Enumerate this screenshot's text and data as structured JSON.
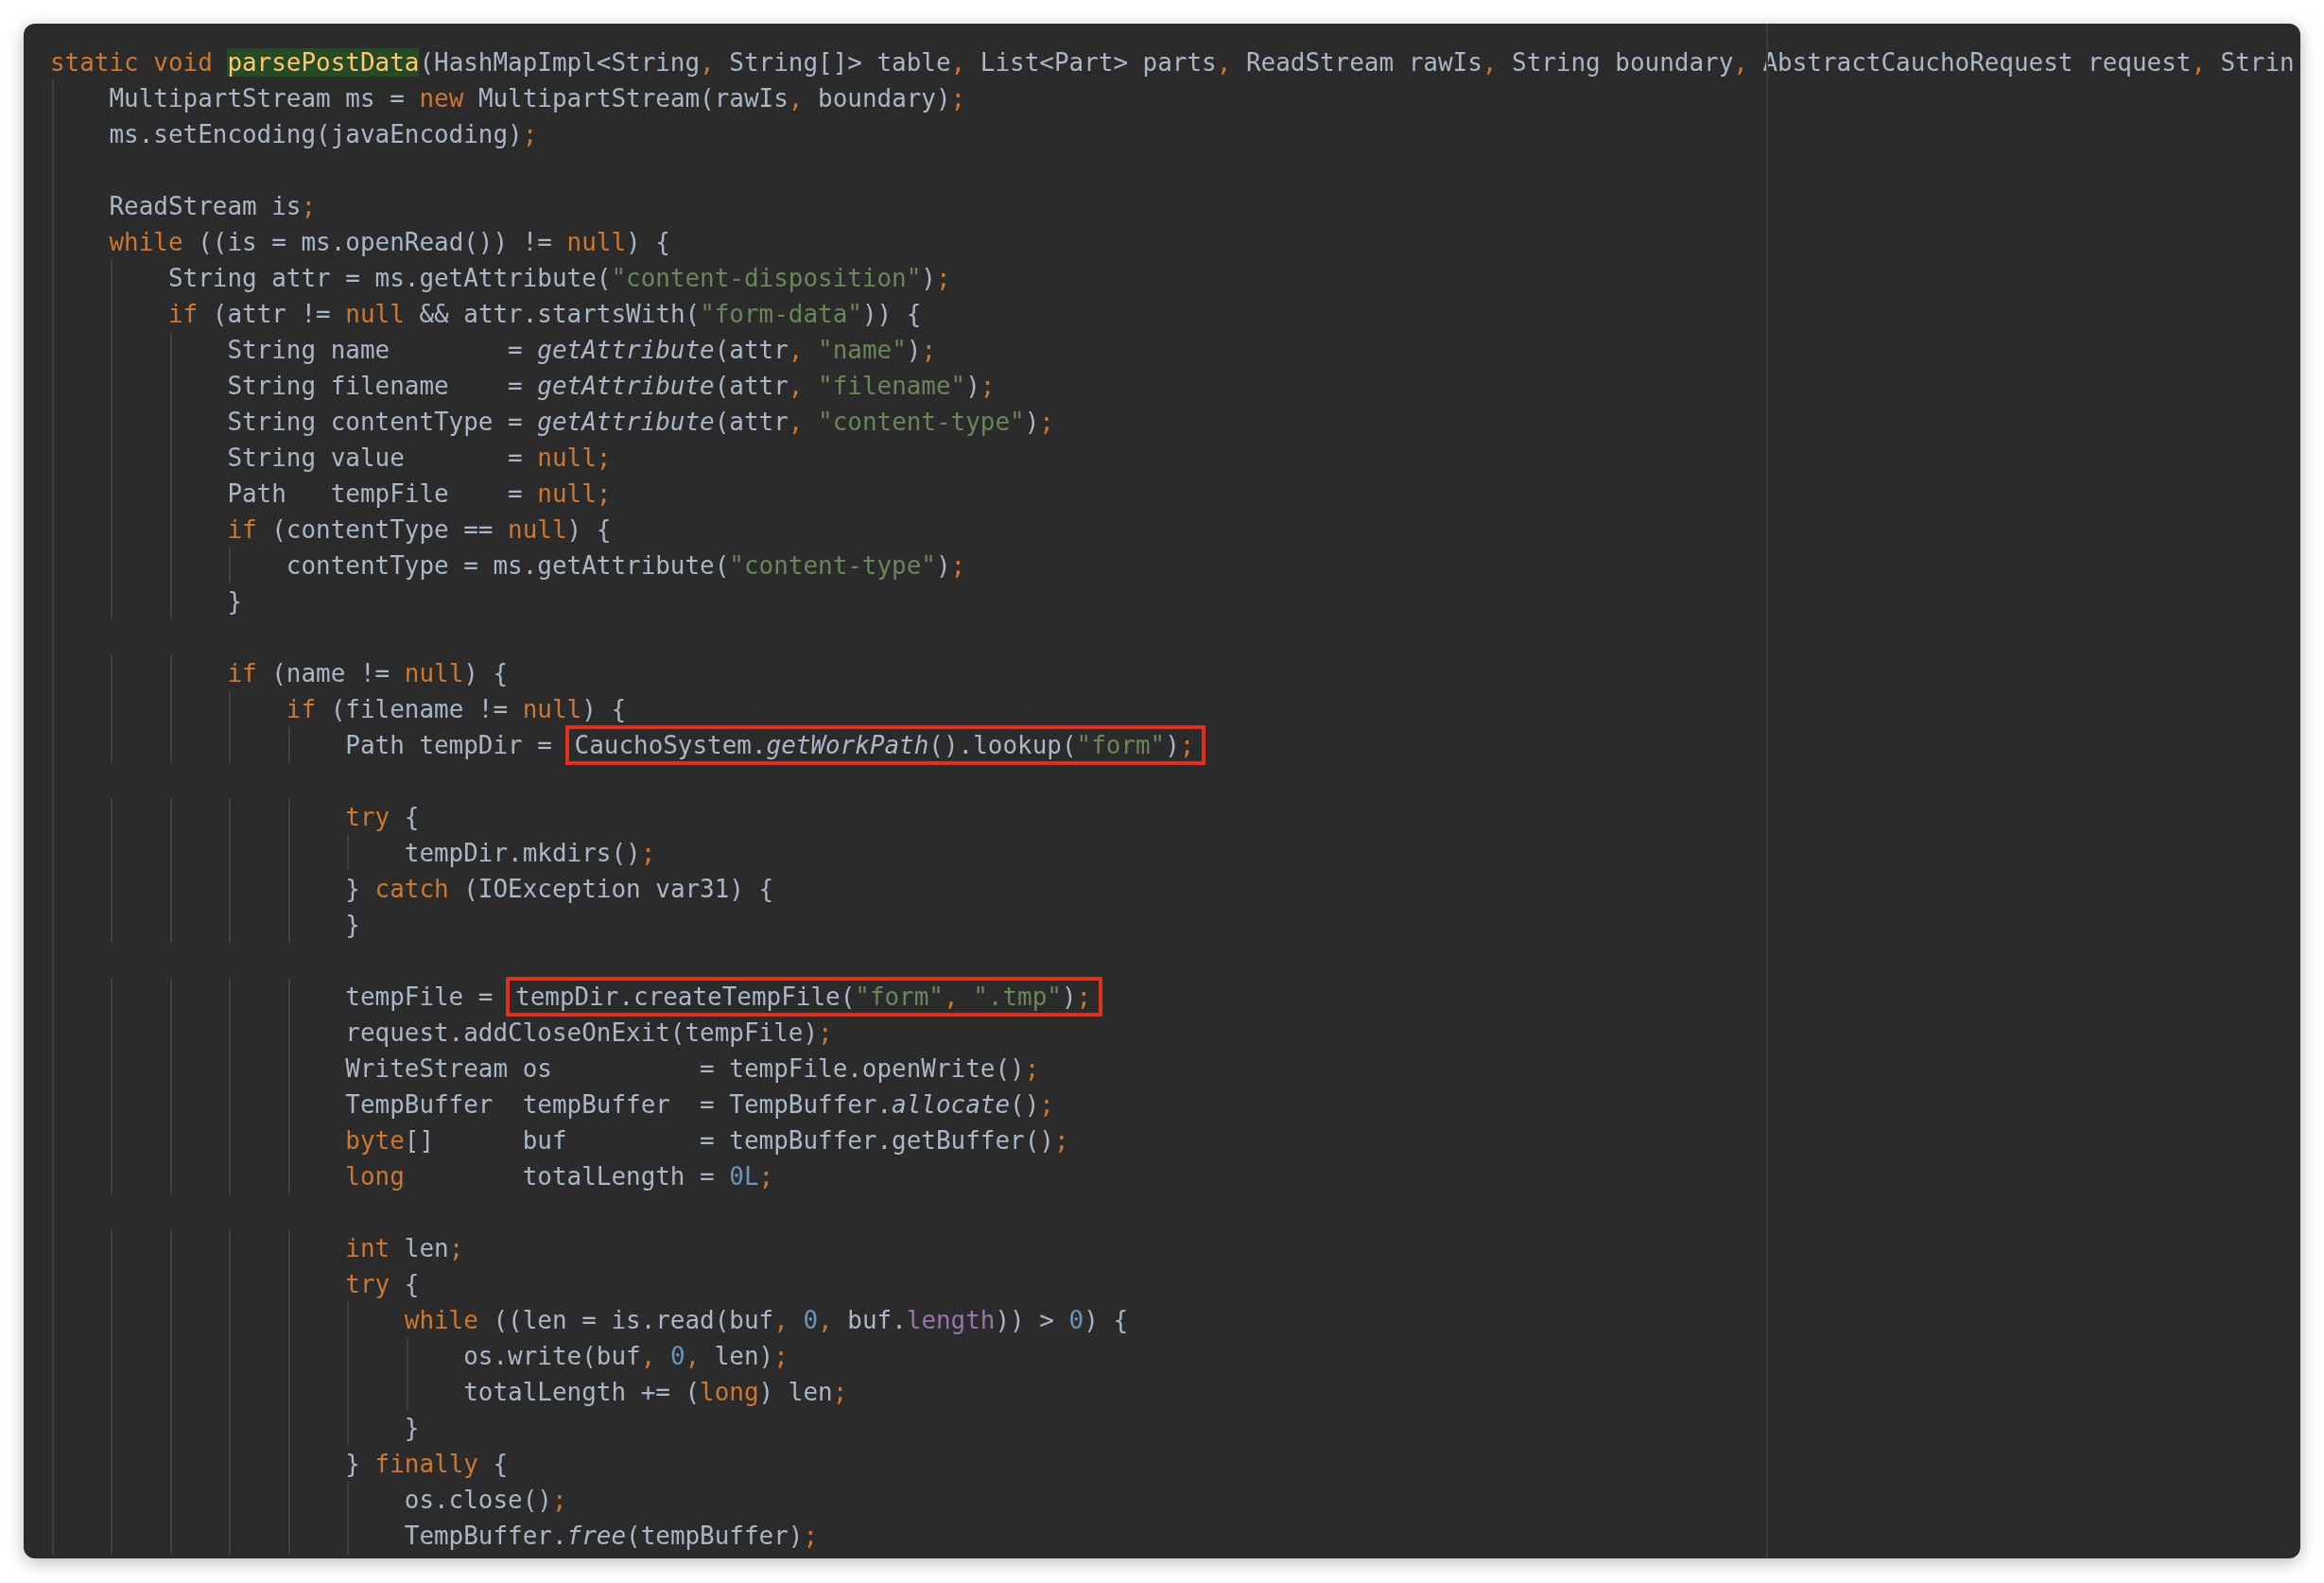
{
  "editor": {
    "lines": [
      {
        "kind": "code",
        "tokens": [
          {
            "text": "static void ",
            "kind": "keyword"
          },
          {
            "text": "parsePostData",
            "kind": "declaration"
          },
          {
            "text": "(HashMapImpl<String",
            "kind": "plain"
          },
          {
            "text": ",",
            "kind": "keyword"
          },
          {
            "text": " String[]> table",
            "kind": "plain"
          },
          {
            "text": ",",
            "kind": "keyword"
          },
          {
            "text": " List<Part> parts",
            "kind": "plain"
          },
          {
            "text": ",",
            "kind": "keyword"
          },
          {
            "text": " ReadStream rawIs",
            "kind": "plain"
          },
          {
            "text": ",",
            "kind": "keyword"
          },
          {
            "text": " String boundary",
            "kind": "plain"
          },
          {
            "text": ",",
            "kind": "keyword"
          },
          {
            "text": " AbstractCauchoRequest request",
            "kind": "plain"
          },
          {
            "text": ",",
            "kind": "keyword"
          },
          {
            "text": " Strin",
            "kind": "plain"
          }
        ]
      },
      {
        "kind": "code",
        "tokens": [
          {
            "text": "    MultipartStream ms = ",
            "kind": "plain"
          },
          {
            "text": "new",
            "kind": "keyword"
          },
          {
            "text": " MultipartStream(rawIs",
            "kind": "plain"
          },
          {
            "text": ",",
            "kind": "keyword"
          },
          {
            "text": " boundary)",
            "kind": "plain"
          },
          {
            "text": ";",
            "kind": "keyword"
          }
        ]
      },
      {
        "kind": "code",
        "tokens": [
          {
            "text": "    ms.setEncoding(javaEncoding)",
            "kind": "plain"
          },
          {
            "text": ";",
            "kind": "keyword"
          }
        ]
      },
      {
        "kind": "blank"
      },
      {
        "kind": "code",
        "tokens": [
          {
            "text": "    ReadStream is",
            "kind": "plain"
          },
          {
            "text": ";",
            "kind": "keyword"
          }
        ]
      },
      {
        "kind": "code",
        "tokens": [
          {
            "text": "    while",
            "kind": "keyword"
          },
          {
            "text": " ((is = ms.openRead()) != ",
            "kind": "plain"
          },
          {
            "text": "null",
            "kind": "keyword"
          },
          {
            "text": ") {",
            "kind": "plain"
          }
        ]
      },
      {
        "kind": "code",
        "tokens": [
          {
            "text": "        String attr = ms.getAttribute(",
            "kind": "plain"
          },
          {
            "text": "\"content-disposition\"",
            "kind": "string"
          },
          {
            "text": ")",
            "kind": "plain"
          },
          {
            "text": ";",
            "kind": "keyword"
          }
        ]
      },
      {
        "kind": "code",
        "tokens": [
          {
            "text": "        if",
            "kind": "keyword"
          },
          {
            "text": " (attr != ",
            "kind": "plain"
          },
          {
            "text": "null",
            "kind": "keyword"
          },
          {
            "text": " && attr.startsWith(",
            "kind": "plain"
          },
          {
            "text": "\"form-data\"",
            "kind": "string"
          },
          {
            "text": ")) {",
            "kind": "plain"
          }
        ]
      },
      {
        "kind": "code",
        "tokens": [
          {
            "text": "            String name        = ",
            "kind": "plain"
          },
          {
            "text": "getAttribute",
            "kind": "static_call"
          },
          {
            "text": "(attr",
            "kind": "plain"
          },
          {
            "text": ",",
            "kind": "keyword"
          },
          {
            "text": " \"name\"",
            "kind": "string"
          },
          {
            "text": ")",
            "kind": "plain"
          },
          {
            "text": ";",
            "kind": "keyword"
          }
        ]
      },
      {
        "kind": "code",
        "tokens": [
          {
            "text": "            String filename    = ",
            "kind": "plain"
          },
          {
            "text": "getAttribute",
            "kind": "static_call"
          },
          {
            "text": "(attr",
            "kind": "plain"
          },
          {
            "text": ",",
            "kind": "keyword"
          },
          {
            "text": " \"filename\"",
            "kind": "string"
          },
          {
            "text": ")",
            "kind": "plain"
          },
          {
            "text": ";",
            "kind": "keyword"
          }
        ]
      },
      {
        "kind": "code",
        "tokens": [
          {
            "text": "            String contentType = ",
            "kind": "plain"
          },
          {
            "text": "getAttribute",
            "kind": "static_call"
          },
          {
            "text": "(attr",
            "kind": "plain"
          },
          {
            "text": ",",
            "kind": "keyword"
          },
          {
            "text": " \"content-type\"",
            "kind": "string"
          },
          {
            "text": ")",
            "kind": "plain"
          },
          {
            "text": ";",
            "kind": "keyword"
          }
        ]
      },
      {
        "kind": "code",
        "tokens": [
          {
            "text": "            String value       = ",
            "kind": "plain"
          },
          {
            "text": "null;",
            "kind": "keyword"
          }
        ]
      },
      {
        "kind": "code",
        "tokens": [
          {
            "text": "            Path   tempFile    = ",
            "kind": "plain"
          },
          {
            "text": "null;",
            "kind": "keyword"
          }
        ]
      },
      {
        "kind": "code",
        "tokens": [
          {
            "text": "            if",
            "kind": "keyword"
          },
          {
            "text": " (contentType == ",
            "kind": "plain"
          },
          {
            "text": "null",
            "kind": "keyword"
          },
          {
            "text": ") {",
            "kind": "plain"
          }
        ]
      },
      {
        "kind": "code",
        "tokens": [
          {
            "text": "                contentType = ms.getAttribute(",
            "kind": "plain"
          },
          {
            "text": "\"content-type\"",
            "kind": "string"
          },
          {
            "text": ")",
            "kind": "plain"
          },
          {
            "text": ";",
            "kind": "keyword"
          }
        ]
      },
      {
        "kind": "code",
        "tokens": [
          {
            "text": "            }",
            "kind": "plain"
          }
        ]
      },
      {
        "kind": "blank"
      },
      {
        "kind": "code",
        "tokens": [
          {
            "text": "            if",
            "kind": "keyword"
          },
          {
            "text": " (name != ",
            "kind": "plain"
          },
          {
            "text": "null",
            "kind": "keyword"
          },
          {
            "text": ") {",
            "kind": "plain"
          }
        ]
      },
      {
        "kind": "code",
        "tokens": [
          {
            "text": "                if",
            "kind": "keyword"
          },
          {
            "text": " (filename != ",
            "kind": "plain"
          },
          {
            "text": "null",
            "kind": "keyword"
          },
          {
            "text": ") {",
            "kind": "plain"
          }
        ]
      },
      {
        "kind": "code",
        "tokens": [
          {
            "text": "                    Path tempDir = ",
            "kind": "plain"
          },
          {
            "kind": "highlight_box",
            "tokens": [
              {
                "text": "CauchoSystem.",
                "kind": "plain"
              },
              {
                "text": "getWorkPath",
                "kind": "static_call"
              },
              {
                "text": "().lookup(",
                "kind": "plain"
              },
              {
                "text": "\"form\"",
                "kind": "string"
              },
              {
                "text": ")",
                "kind": "plain"
              },
              {
                "text": ";",
                "kind": "keyword"
              }
            ]
          }
        ]
      },
      {
        "kind": "blank"
      },
      {
        "kind": "code",
        "tokens": [
          {
            "text": "                    try",
            "kind": "keyword"
          },
          {
            "text": " {",
            "kind": "plain"
          }
        ]
      },
      {
        "kind": "code",
        "tokens": [
          {
            "text": "                        tempDir.mkdirs()",
            "kind": "plain"
          },
          {
            "text": ";",
            "kind": "keyword"
          }
        ]
      },
      {
        "kind": "code",
        "tokens": [
          {
            "text": "                    } ",
            "kind": "plain"
          },
          {
            "text": "catch",
            "kind": "keyword"
          },
          {
            "text": " (IOException var31) {",
            "kind": "plain"
          }
        ]
      },
      {
        "kind": "code",
        "tokens": [
          {
            "text": "                    }",
            "kind": "plain"
          }
        ]
      },
      {
        "kind": "blank"
      },
      {
        "kind": "code",
        "tokens": [
          {
            "text": "                    tempFile = ",
            "kind": "plain"
          },
          {
            "kind": "highlight_box",
            "tokens": [
              {
                "text": "tempDir.createTempFile(",
                "kind": "plain"
              },
              {
                "text": "\"form\"",
                "kind": "string"
              },
              {
                "text": ",",
                "kind": "keyword"
              },
              {
                "text": " \".tmp\"",
                "kind": "string"
              },
              {
                "text": ")",
                "kind": "plain"
              },
              {
                "text": ";",
                "kind": "keyword"
              }
            ]
          }
        ]
      },
      {
        "kind": "code",
        "tokens": [
          {
            "text": "                    request.addCloseOnExit(tempFile)",
            "kind": "plain"
          },
          {
            "text": ";",
            "kind": "keyword"
          }
        ]
      },
      {
        "kind": "code",
        "tokens": [
          {
            "text": "                    WriteStream os          = tempFile.openWrite()",
            "kind": "plain"
          },
          {
            "text": ";",
            "kind": "keyword"
          }
        ]
      },
      {
        "kind": "code",
        "tokens": [
          {
            "text": "                    TempBuffer  tempBuffer  = TempBuffer.",
            "kind": "plain"
          },
          {
            "text": "allocate",
            "kind": "static_call"
          },
          {
            "text": "()",
            "kind": "plain"
          },
          {
            "text": ";",
            "kind": "keyword"
          }
        ]
      },
      {
        "kind": "code",
        "tokens": [
          {
            "text": "                    byte",
            "kind": "keyword"
          },
          {
            "text": "[]      buf         = tempBuffer.getBuffer()",
            "kind": "plain"
          },
          {
            "text": ";",
            "kind": "keyword"
          }
        ]
      },
      {
        "kind": "code",
        "tokens": [
          {
            "text": "                    long",
            "kind": "keyword"
          },
          {
            "text": "        totalLength = ",
            "kind": "plain"
          },
          {
            "text": "0L",
            "kind": "number"
          },
          {
            "text": ";",
            "kind": "keyword"
          }
        ]
      },
      {
        "kind": "blank"
      },
      {
        "kind": "code",
        "tokens": [
          {
            "text": "                    int",
            "kind": "keyword"
          },
          {
            "text": " len",
            "kind": "plain"
          },
          {
            "text": ";",
            "kind": "keyword"
          }
        ]
      },
      {
        "kind": "code",
        "tokens": [
          {
            "text": "                    try",
            "kind": "keyword"
          },
          {
            "text": " {",
            "kind": "plain"
          }
        ]
      },
      {
        "kind": "code",
        "tokens": [
          {
            "text": "                        while",
            "kind": "keyword"
          },
          {
            "text": " ((len = is.read(buf",
            "kind": "plain"
          },
          {
            "text": ",",
            "kind": "keyword"
          },
          {
            "text": " 0",
            "kind": "number"
          },
          {
            "text": ",",
            "kind": "keyword"
          },
          {
            "text": " buf.",
            "kind": "plain"
          },
          {
            "text": "length",
            "kind": "field"
          },
          {
            "text": ")) > ",
            "kind": "plain"
          },
          {
            "text": "0",
            "kind": "number"
          },
          {
            "text": ") {",
            "kind": "plain"
          }
        ]
      },
      {
        "kind": "code",
        "tokens": [
          {
            "text": "                            os.write(buf",
            "kind": "plain"
          },
          {
            "text": ",",
            "kind": "keyword"
          },
          {
            "text": " 0",
            "kind": "number"
          },
          {
            "text": ",",
            "kind": "keyword"
          },
          {
            "text": " len)",
            "kind": "plain"
          },
          {
            "text": ";",
            "kind": "keyword"
          }
        ]
      },
      {
        "kind": "code",
        "tokens": [
          {
            "text": "                            totalLength += (",
            "kind": "plain"
          },
          {
            "text": "long",
            "kind": "keyword"
          },
          {
            "text": ") len",
            "kind": "plain"
          },
          {
            "text": ";",
            "kind": "keyword"
          }
        ]
      },
      {
        "kind": "code",
        "tokens": [
          {
            "text": "                        }",
            "kind": "plain"
          }
        ]
      },
      {
        "kind": "code",
        "tokens": [
          {
            "text": "                    } ",
            "kind": "plain"
          },
          {
            "text": "finally",
            "kind": "keyword"
          },
          {
            "text": " {",
            "kind": "plain"
          }
        ]
      },
      {
        "kind": "code",
        "tokens": [
          {
            "text": "                        os.close()",
            "kind": "plain"
          },
          {
            "text": ";",
            "kind": "keyword"
          }
        ]
      },
      {
        "kind": "code",
        "tokens": [
          {
            "text": "                        TempBuffer.",
            "kind": "plain"
          },
          {
            "text": "free",
            "kind": "static_call"
          },
          {
            "text": "(tempBuffer)",
            "kind": "plain"
          },
          {
            "text": ";",
            "kind": "keyword"
          }
        ]
      }
    ]
  }
}
